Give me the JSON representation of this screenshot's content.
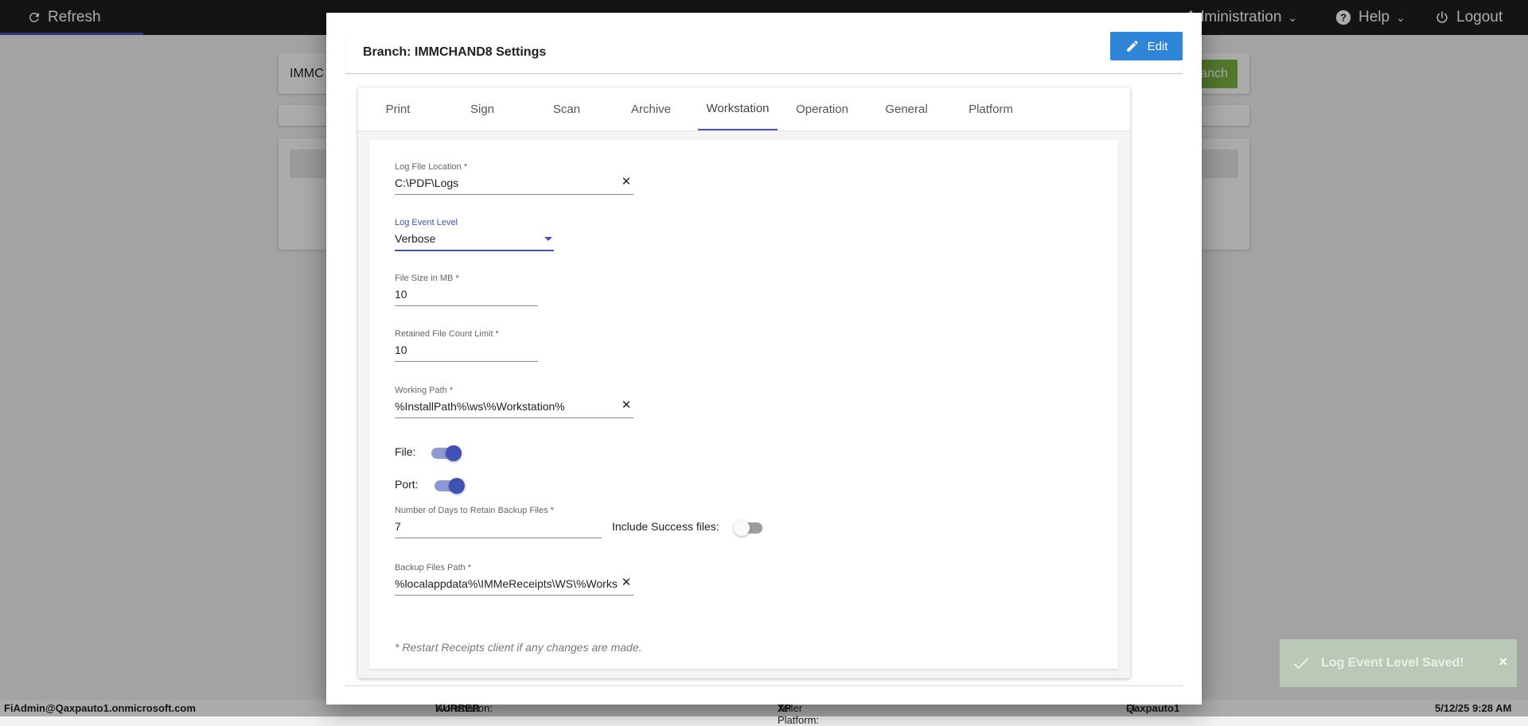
{
  "topbar": {
    "refresh_label": "Refresh",
    "administration_label": "Administration",
    "help_label": "Help",
    "logout_label": "Logout"
  },
  "background": {
    "branch_input_partial": "IMMC",
    "add_button_partial": "anch"
  },
  "modal": {
    "title": "Branch: IMMCHAND8 Settings",
    "edit_label": "Edit",
    "tabs": [
      {
        "label": "Print"
      },
      {
        "label": "Sign"
      },
      {
        "label": "Scan"
      },
      {
        "label": "Archive"
      },
      {
        "label": "Workstation"
      },
      {
        "label": "Operation"
      },
      {
        "label": "General"
      },
      {
        "label": "Platform"
      }
    ],
    "active_tab": "Workstation",
    "form": {
      "log_file_location": {
        "label": "Log File Location *",
        "value": "C:\\PDF\\Logs"
      },
      "log_event_level": {
        "label": "Log Event Level",
        "value": "Verbose"
      },
      "file_size": {
        "label": "File Size in MB *",
        "value": "10"
      },
      "retained_count": {
        "label": "Retained File Count Limit *",
        "value": "10"
      },
      "working_path": {
        "label": "Working Path *",
        "value": "%InstallPath%\\ws\\%Workstation%"
      },
      "file_toggle": {
        "label": "File:",
        "on": true
      },
      "port_toggle": {
        "label": "Port:",
        "on": true
      },
      "retain_days": {
        "label": "Number of Days to Retain Backup Files *",
        "value": "7"
      },
      "include_success": {
        "label": "Include Success files:",
        "on": false
      },
      "backup_path": {
        "label": "Backup Files Path *",
        "value": "%localappdata%\\IMMeReceipts\\WS\\%Workstation%"
      },
      "note": "* Restart Receipts client if any changes are made."
    }
  },
  "toast": {
    "message": "Log Event Level Saved!",
    "close": "×"
  },
  "statusbar": {
    "user": "FiAdmin@Qaxpauto1.onmicrosoft.com",
    "workstation_label": "Workstation:",
    "workstation_value": "KURRER",
    "teller_label": "Teller Platform:",
    "teller_value": "XP",
    "fi_label": "FI:",
    "fi_value": "Qaxpauto1",
    "datetime": "5/12/25 9:28 AM"
  },
  "icons": {
    "refresh": "refresh-icon",
    "edit": "pencil-icon",
    "clear": "close-icon",
    "check": "check-icon"
  },
  "colors": {
    "accent": "#3f51b5",
    "edit_button": "#2f86d9",
    "toast": "#b9c9b6",
    "topbar": "#1f1f1f"
  }
}
